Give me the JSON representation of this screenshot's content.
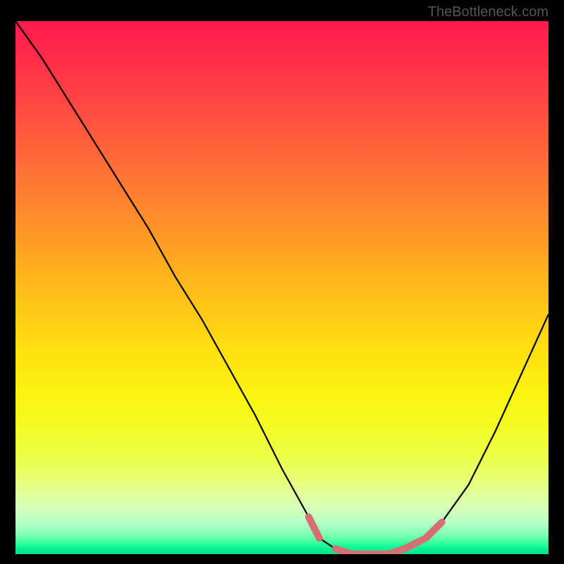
{
  "watermark": "TheBottleneck.com",
  "chart_data": {
    "type": "line",
    "title": "",
    "xlabel": "",
    "ylabel": "",
    "xlim": [
      0,
      100
    ],
    "ylim": [
      0,
      100
    ],
    "x": [
      0,
      5,
      10,
      15,
      20,
      25,
      30,
      35,
      40,
      45,
      50,
      55,
      57,
      60,
      63,
      66,
      70,
      73,
      77,
      80,
      85,
      90,
      95,
      100
    ],
    "values": [
      100,
      93,
      85,
      77,
      69,
      61,
      52,
      44,
      35,
      26,
      16,
      7,
      3,
      1,
      0,
      0,
      0,
      1,
      3,
      6,
      13,
      23,
      34,
      45
    ],
    "highlight_segments": [
      {
        "x": [
          55,
          57
        ],
        "values": [
          7,
          3
        ],
        "color": "#d47070"
      },
      {
        "x": [
          60,
          63,
          66,
          70,
          73,
          77,
          80
        ],
        "values": [
          1,
          0,
          0,
          0,
          1,
          3,
          6
        ],
        "color": "#d47070"
      }
    ],
    "background": "rainbow-vertical-gradient"
  }
}
